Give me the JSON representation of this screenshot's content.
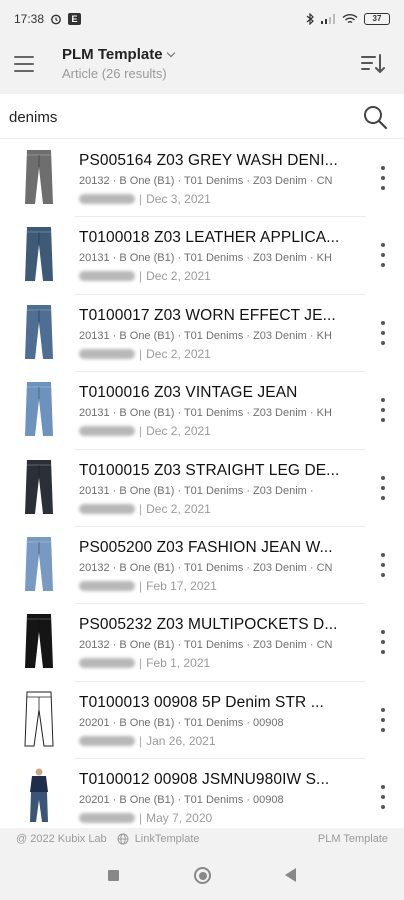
{
  "status": {
    "time": "17:38",
    "battery": "37"
  },
  "header": {
    "title": "PLM Template",
    "subtitle": "Article (26  results)"
  },
  "search": {
    "value": "denims"
  },
  "items": [
    {
      "title": "PS005164 Z03 GREY WASH DENI...",
      "meta": "20132 · B One (B1) · T01 Denims · Z03 Denim · CN",
      "date": "Dec 3, 2021",
      "thumb": "grey-jeans",
      "color": "#6e6e6e"
    },
    {
      "title": "T0100018 Z03 LEATHER APPLICA...",
      "meta": "20131 · B One (B1) · T01 Denims · Z03 Denim · KH",
      "date": "Dec 2, 2021",
      "thumb": "blue-jeans",
      "color": "#3f5a78"
    },
    {
      "title": "T0100017 Z03 WORN EFFECT JE...",
      "meta": "20131 · B One (B1) · T01 Denims · Z03 Denim · KH",
      "date": "Dec 2, 2021",
      "thumb": "blue-jeans",
      "color": "#4e6e93"
    },
    {
      "title": "T0100016 Z03 VINTAGE JEAN",
      "meta": "20131 · B One (B1) · T01 Denims · Z03 Denim · KH",
      "date": "Dec 2, 2021",
      "thumb": "light-jeans",
      "color": "#6d92bd"
    },
    {
      "title": "T0100015 Z03 STRAIGHT LEG DE...",
      "meta": "20131 · B One (B1) · T01 Denims · Z03 Denim ·",
      "date": "Dec 2, 2021",
      "thumb": "dark-jeans",
      "color": "#2b2f38"
    },
    {
      "title": "PS005200 Z03 FASHION JEAN W...",
      "meta": "20132 · B One (B1) · T01 Denims · Z03 Denim · CN",
      "date": "Feb 17, 2021",
      "thumb": "light-jeans",
      "color": "#7799c2"
    },
    {
      "title": "PS005232 Z03 MULTIPOCKETS D...",
      "meta": "20132 · B One (B1) · T01 Denims · Z03 Denim · CN",
      "date": "Feb 1, 2021",
      "thumb": "black-jeans",
      "color": "#151515"
    },
    {
      "title": "T0100013 00908 5P Denim STR ...",
      "meta": "20201 · B One (B1) · T01 Denims · 00908",
      "date": "Jan 26, 2021",
      "thumb": "sketch-jeans",
      "color": "#ffffff"
    },
    {
      "title": "T0100012 00908 JSMNU980IW S...",
      "meta": "20201 · B One (B1) · T01 Denims · 00908",
      "date": "May 7, 2020",
      "thumb": "model-jeans",
      "color": "#3b5578"
    }
  ],
  "footer": {
    "copyright": "@ 2022 Kubix Lab",
    "link": "LinkTemplate",
    "right": "PLM Template"
  }
}
